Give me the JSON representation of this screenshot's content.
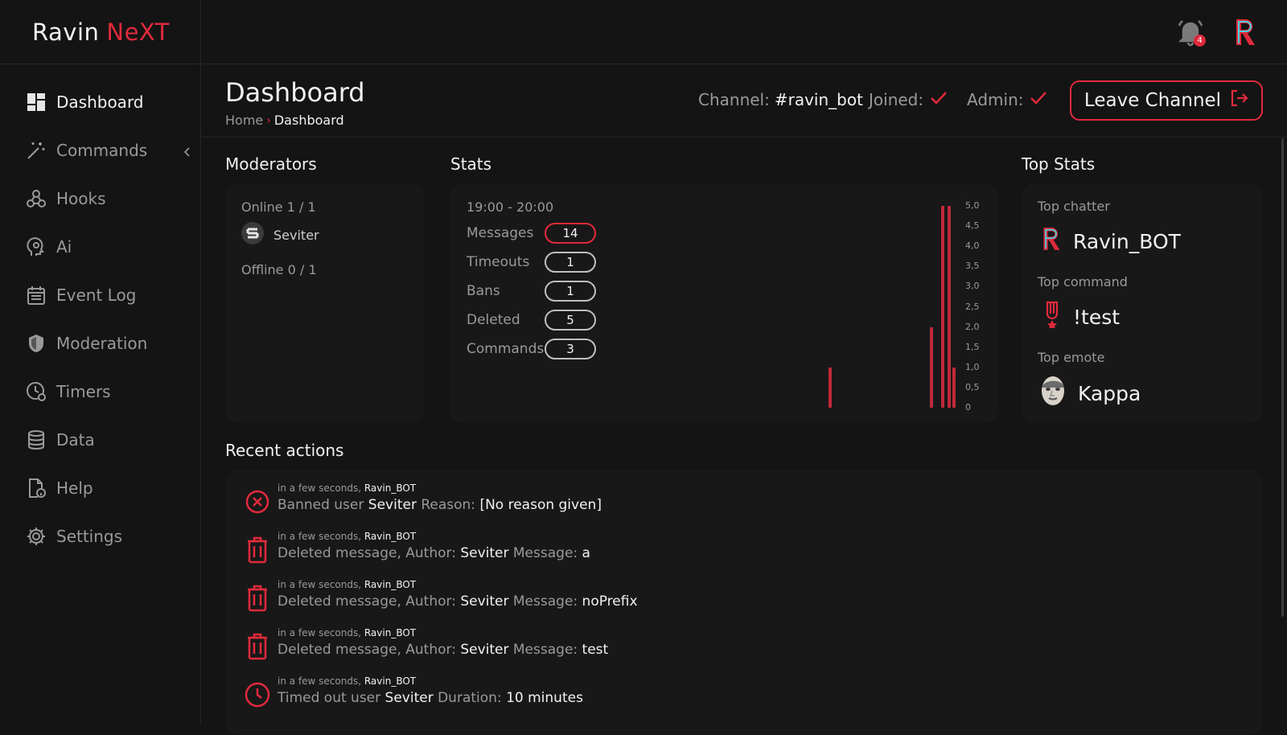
{
  "app": {
    "name_part1": "Ravin",
    "name_part2": "NeXT"
  },
  "notifications": {
    "count": "4"
  },
  "sidebar": {
    "items": [
      {
        "label": "Dashboard",
        "icon": "dashboard-icon",
        "active": true
      },
      {
        "label": "Commands",
        "icon": "magic-wand-icon"
      },
      {
        "label": "Hooks",
        "icon": "webhook-icon"
      },
      {
        "label": "Ai",
        "icon": "ai-head-icon"
      },
      {
        "label": "Event Log",
        "icon": "calendar-log-icon"
      },
      {
        "label": "Moderation",
        "icon": "shield-icon"
      },
      {
        "label": "Timers",
        "icon": "clock-icon"
      },
      {
        "label": "Data",
        "icon": "database-icon"
      },
      {
        "label": "Help",
        "icon": "help-doc-icon"
      },
      {
        "label": "Settings",
        "icon": "gear-icon"
      }
    ]
  },
  "header": {
    "title": "Dashboard",
    "breadcrumb": {
      "home": "Home",
      "current": "Dashboard"
    },
    "channel_label": "Channel:",
    "channel_value": "#ravin_bot",
    "joined_label": "Joined:",
    "admin_label": "Admin:",
    "leave_label": "Leave Channel"
  },
  "moderators": {
    "title": "Moderators",
    "online_label": "Online 1 / 1",
    "online_users": [
      "Seviter"
    ],
    "offline_label": "Offline 0 / 1"
  },
  "stats": {
    "title": "Stats",
    "time_range": "19:00 - 20:00",
    "rows": [
      {
        "label": "Messages",
        "value": "14"
      },
      {
        "label": "Timeouts",
        "value": "1"
      },
      {
        "label": "Bans",
        "value": "1"
      },
      {
        "label": "Deleted",
        "value": "5"
      },
      {
        "label": "Commands",
        "value": "3"
      }
    ]
  },
  "chart_data": {
    "type": "bar",
    "ylim": [
      0,
      5
    ],
    "y_ticks": [
      "5,0",
      "4,5",
      "4,0",
      "3,5",
      "3,0",
      "2,5",
      "2,0",
      "1,5",
      "1,0",
      "0,5",
      "0"
    ],
    "series_color": "#c0283a",
    "values": [
      1,
      2,
      5,
      5,
      1
    ]
  },
  "top_stats": {
    "title": "Top Stats",
    "chatter_label": "Top chatter",
    "chatter_value": "Ravin_BOT",
    "command_label": "Top command",
    "command_value": "!test",
    "emote_label": "Top emote",
    "emote_value": "Kappa"
  },
  "recent": {
    "title": "Recent actions",
    "items": [
      {
        "icon": "ban-icon",
        "time": "in a few seconds,",
        "actor": "Ravin_BOT",
        "parts": [
          "Banned user",
          "Seviter",
          "Reason:",
          "[No reason given]"
        ]
      },
      {
        "icon": "trash-icon",
        "time": "in a few seconds,",
        "actor": "Ravin_BOT",
        "parts": [
          "Deleted message, Author:",
          "Seviter",
          "Message:",
          "a"
        ]
      },
      {
        "icon": "trash-icon",
        "time": "in a few seconds,",
        "actor": "Ravin_BOT",
        "parts": [
          "Deleted message, Author:",
          "Seviter",
          "Message:",
          "noPrefix"
        ]
      },
      {
        "icon": "trash-icon",
        "time": "in a few seconds,",
        "actor": "Ravin_BOT",
        "parts": [
          "Deleted message, Author:",
          "Seviter",
          "Message:",
          "test"
        ]
      },
      {
        "icon": "clock-icon",
        "time": "in a few seconds,",
        "actor": "Ravin_BOT",
        "parts": [
          "Timed out user",
          "Seviter",
          "Duration:",
          "10 minutes"
        ]
      }
    ]
  },
  "colors": {
    "accent": "#e02a3c",
    "background": "#141414",
    "card": "#181818"
  }
}
